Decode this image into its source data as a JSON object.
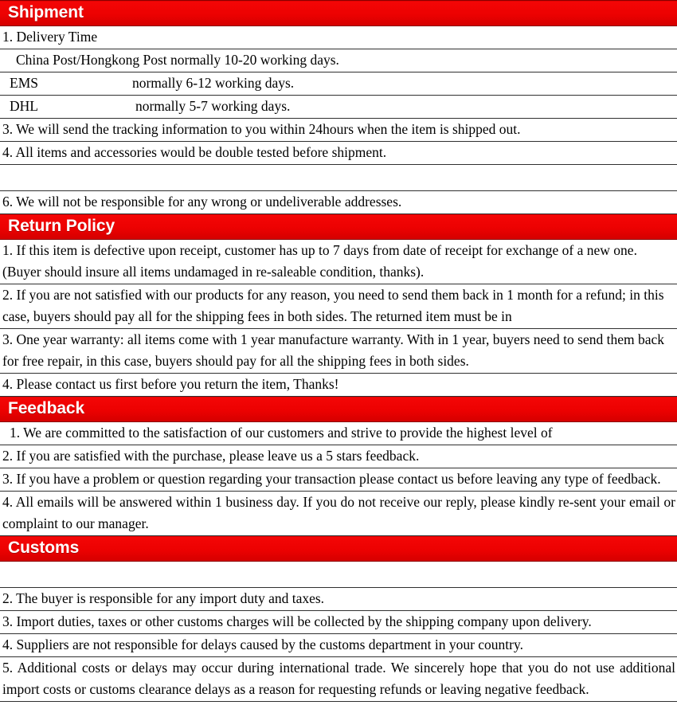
{
  "document": {
    "title": "Shipment / Return Policy / Feedback / Customs",
    "accent_color": "#ee0202",
    "header_text_color": "#ffffff",
    "body_text_color": "#000000",
    "border_color": "#303030",
    "background_color": "#ffffff"
  },
  "sections": [
    {
      "heading": "Shipment",
      "rows": [
        {
          "text": "1. Delivery Time"
        },
        {
          "text": "China Post/Hongkong Post normally 10-20 working days."
        },
        {
          "label": "EMS",
          "text": "normally 6-12 working days."
        },
        {
          "label": "DHL",
          "text": "normally 5-7 working days."
        },
        {
          "text": "3. We will send the tracking information to you within 24hours when the item is shipped out."
        },
        {
          "text": "4. All items and accessories would be double tested before shipment."
        },
        {
          "text": ""
        },
        {
          "text": "6. We will not be responsible for any wrong or undeliverable addresses."
        }
      ]
    },
    {
      "heading": "Return Policy",
      "rows": [
        {
          "text": "1. If this item is defective upon receipt, customer has up to 7 days from date of receipt for exchange of a new one. (Buyer should insure all items undamaged in re-saleable condition, thanks)."
        },
        {
          "text": "2. If you are not satisfied with our products for any reason, you need to send them back in 1 month for a refund; in this case, buyers should pay all for the shipping fees in both sides. The returned item must be in"
        },
        {
          "text": "3. One year warranty: all items come with 1 year manufacture warranty. With in 1 year, buyers need to send them back for free repair, in this case, buyers should pay for all the shipping fees in both sides."
        },
        {
          "text": "4. Please contact us first before you return the item, Thanks!"
        }
      ]
    },
    {
      "heading": "Feedback",
      "rows": [
        {
          "text": "1. We are committed to the satisfaction of our customers and strive to provide the highest level of"
        },
        {
          "text": "2. If you are satisfied with the purchase, please leave us a 5 stars feedback."
        },
        {
          "text": "3. If you have a problem or question regarding your transaction please contact us before leaving any type of feedback."
        },
        {
          "text": "4. All emails will be answered within 1 business day. If you do not receive our reply, please kindly re-sent your email or complaint to our manager."
        }
      ]
    },
    {
      "heading": "Customs",
      "rows": [
        {
          "text": ""
        },
        {
          "text": "2. The buyer is responsible for any import duty and taxes."
        },
        {
          "text": "3. Import duties, taxes or other customs charges will be collected by the shipping company upon delivery."
        },
        {
          "text": "4. Suppliers are not responsible for delays caused by the customs department in your country."
        },
        {
          "text": "5. Additional costs or delays may occur during international trade. We sincerely hope that you do not use additional import costs or customs clearance delays as a reason for requesting refunds or leaving negative feedback."
        }
      ]
    }
  ]
}
